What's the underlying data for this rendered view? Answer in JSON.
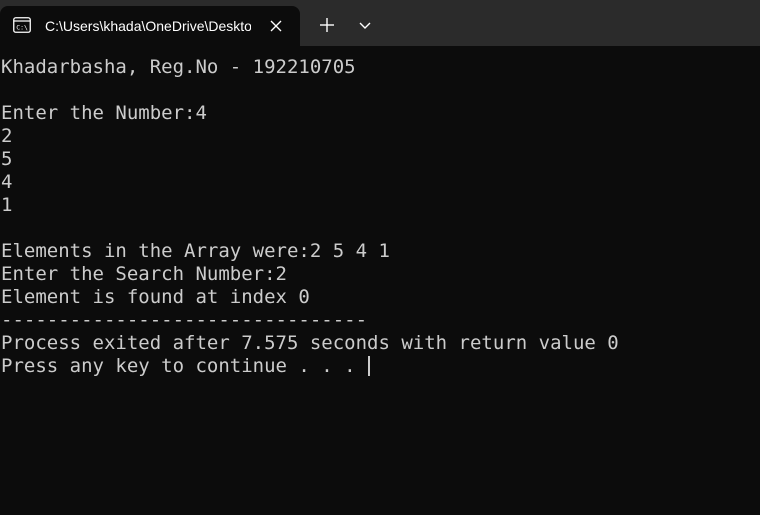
{
  "tab": {
    "title": "C:\\Users\\khada\\OneDrive\\Desktop",
    "icon": "console-icon"
  },
  "tabbar": {
    "close_icon": "close-icon",
    "new_tab_icon": "plus-icon",
    "dropdown_icon": "chevron-down-icon"
  },
  "terminal": {
    "lines": [
      "Khadarbasha, Reg.No - 192210705",
      "",
      "Enter the Number:4",
      "2",
      "5",
      "4",
      "1",
      "",
      "Elements in the Array were:2 5 4 1",
      "Enter the Search Number:2",
      "Element is found at index 0",
      "--------------------------------",
      "Process exited after 7.575 seconds with return value 0",
      "Press any key to continue . . . "
    ]
  },
  "colors": {
    "background": "#0c0c0c",
    "tabbar": "#2b2b2b",
    "text": "#cccccc"
  }
}
